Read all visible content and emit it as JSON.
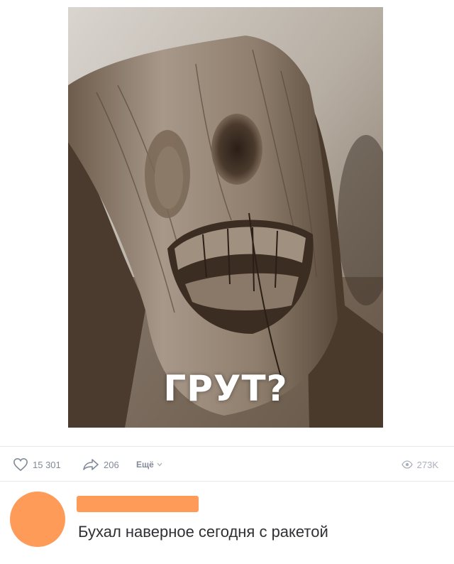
{
  "post": {
    "image_caption": "ГРУТ?"
  },
  "actions": {
    "likes": "15 301",
    "shares": "206",
    "more_label": "Ещё",
    "views": "273K"
  },
  "comment": {
    "text": "Бухал наверное сегодня с ракетой"
  },
  "icons": {
    "like": "heart-icon",
    "share": "share-arrow-icon",
    "more": "chevron-down-icon",
    "views": "eye-icon"
  },
  "colors": {
    "accent_orange": "#ff9b59",
    "meta_gray": "#828a99",
    "text": "#2f3033"
  }
}
